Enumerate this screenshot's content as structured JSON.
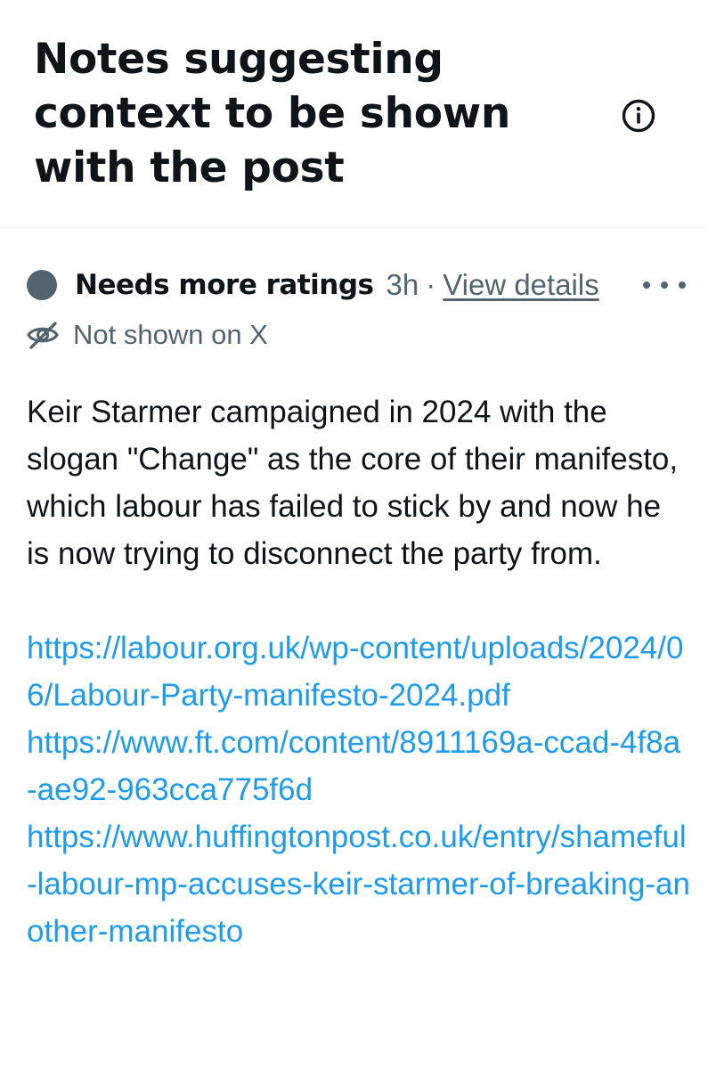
{
  "header": {
    "title": "Notes suggesting context to be shown with the post",
    "info_icon": "info-circle-icon"
  },
  "note": {
    "status": "Needs more ratings",
    "status_color": "#536471",
    "time": "3h",
    "separator": "·",
    "details_link": "View details",
    "more_icon": "more-horizontal-icon",
    "visibility_icon": "eye-off-icon",
    "visibility_text": "Not shown on X",
    "body": "Keir Starmer campaigned in 2024 with the slogan \"Change\" as the core of their manifesto, which labour has failed to stick by and now he is now trying to disconnect the party from.",
    "links": [
      "https://labour.org.uk/wp-content/uploads/2024/06/Labour-Party-manifesto-2024.pdf",
      "https://www.ft.com/content/8911169a-ccad-4f8a-ae92-963cca775f6d",
      "https://www.huffingtonpost.co.uk/entry/shameful-labour-mp-accuses-keir-starmer-of-breaking-another-manifesto"
    ],
    "link_color": "#1d9bf0"
  }
}
